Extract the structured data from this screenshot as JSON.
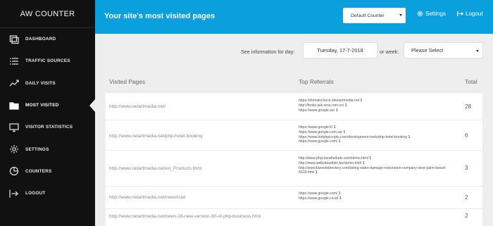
{
  "app": {
    "brand": "AW COUNTER"
  },
  "sidebar": {
    "items": [
      {
        "label": "DASHBOARD",
        "icon": "dashboard-icon"
      },
      {
        "label": "TRAFFIC SOURCES",
        "icon": "list-icon"
      },
      {
        "label": "DAILY VISITS",
        "icon": "trend-icon"
      },
      {
        "label": "MOST VISITED",
        "icon": "folder-icon",
        "active": true
      },
      {
        "label": "VISITOR STATISTICS",
        "icon": "monitor-icon"
      },
      {
        "label": "SETTINGS",
        "icon": "gear-icon"
      },
      {
        "label": "COUNTERS",
        "icon": "pie-icon"
      },
      {
        "label": "LOGOUT",
        "icon": "logout-icon"
      }
    ]
  },
  "header": {
    "title": "Your site's most visited pages",
    "counter_select": "Default Counter",
    "settings_label": "Settings",
    "logout_label": "Logout"
  },
  "filters": {
    "day_label": "See information for day:",
    "day_value": "Tuesday, 17-7-2018",
    "week_label": "or week:",
    "week_value": "Please Select"
  },
  "table": {
    "columns": [
      "Visited Pages",
      "Top Referrals",
      "Total"
    ],
    "rows": [
      {
        "page": "http://www.netartmedia.net/",
        "referrals": [
          {
            "url": "https://domaincheck.iohetartmedia.net",
            "count": "1"
          },
          {
            "url": "http://fenlei.ask.sina.com.cn/",
            "count": "1"
          },
          {
            "url": "https://www.google.ae/",
            "count": "1"
          }
        ],
        "total": "28"
      },
      {
        "page": "http://www.netartmedia.net/php-hotel-booking",
        "referrals": [
          {
            "url": "https://www.google.it/",
            "count": "1"
          },
          {
            "url": "https://www.google.com.sa/",
            "count": "1"
          },
          {
            "url": "https://www.hotphpscripts.com/development-tools/php-hotel-booking",
            "count": "1"
          },
          {
            "url": "https://www.google.com/",
            "count": "1"
          }
        ],
        "total": "6"
      },
      {
        "page": "http://www.netartmedia.net/en_Products.html",
        "referrals": [
          {
            "url": "http://www.phpclassifiedads.com/demo.html",
            "count": "1"
          },
          {
            "url": "http://www.websiteadmin.biz/demo.html",
            "count": "1"
          },
          {
            "url": "http://www.bizwebdirectory.com/listing-water-damage-restoration-company-west-palm-beach-6618.html",
            "count": "1"
          }
        ],
        "total": "3"
      },
      {
        "page": "http://www.netartmedia.net/newslister",
        "referrals": [
          {
            "url": "https://www.google.com/",
            "count": "1"
          },
          {
            "url": "https://www.google.co.id/",
            "count": "1"
          }
        ],
        "total": "2"
      },
      {
        "page": "http://www.netartmedia.net/news-28-new-version-30-of-php-business.html",
        "referrals": [],
        "total": "2"
      }
    ]
  },
  "colors": {
    "header_bg": "#0aa0dd",
    "sidebar_bg": "#111111",
    "page_bg": "#eeeeee"
  }
}
